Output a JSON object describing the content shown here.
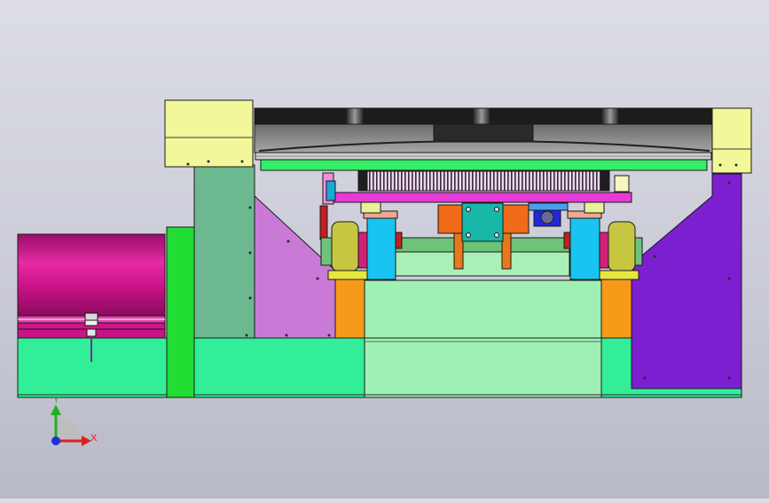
{
  "viewport": {
    "background_top": "#dcdde6",
    "background_bottom": "#b8b9c6"
  },
  "axis_triad": {
    "x_label": "X",
    "y_label": "Y",
    "x_color": "#e02020",
    "y_color": "#20b020",
    "origin_color": "#2030e0"
  },
  "colors": {
    "outline": "#1a1a1a",
    "base": "#33ee99",
    "base_center": "#9ff0b4",
    "left_column": "#6cb890",
    "tall_green_bar": "#22dd33",
    "pale_yellow": "#f2f79a",
    "cylinder": "#d0148c",
    "left_wedge": "#c87ad6",
    "right_plate": "#7b1fd0",
    "orange_block": "#f79a1a",
    "cyan_block": "#18c4f0",
    "teal_plate": "#18b8a8",
    "olive_motor": "#c6c640",
    "magenta_bar": "#e83ad6",
    "top_rail": "#1a1a1a",
    "grey_cover": "#808080",
    "green_rail": "#33ee66",
    "gear": "#ecd5ea",
    "blue_motor": "#2228d8"
  }
}
